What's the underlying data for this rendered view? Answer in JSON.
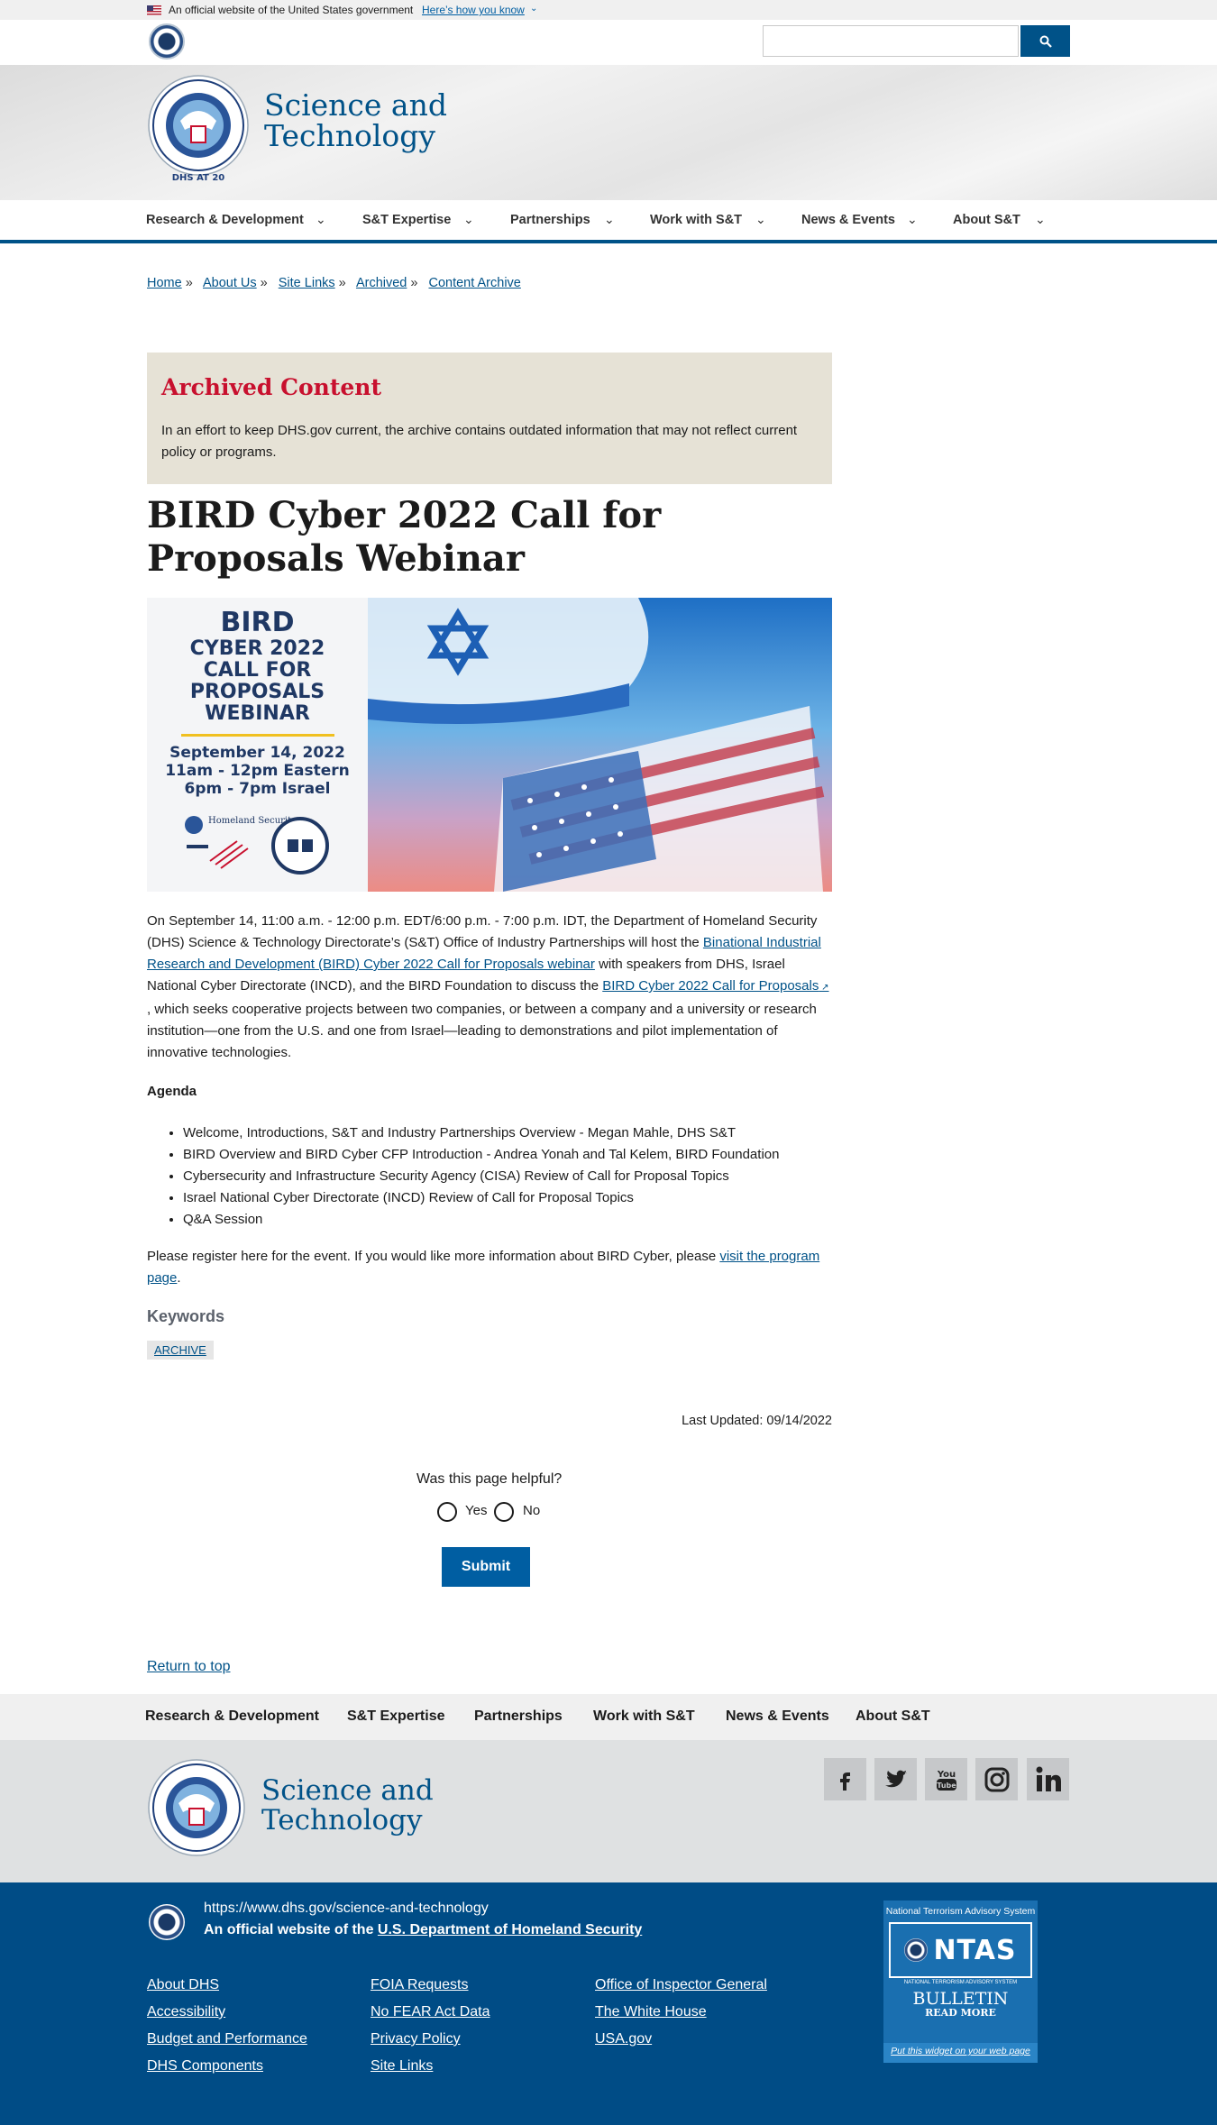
{
  "gov_banner": {
    "text": "An official website of the United States government",
    "how_link": "Here’s how you know"
  },
  "brand": {
    "line1": "Science and",
    "line2": "Technology",
    "seal_text": "DHS AT 20"
  },
  "main_nav": [
    "Research & Development",
    "S&T Expertise",
    "Partnerships",
    "Work with S&T",
    "News & Events",
    "About S&T"
  ],
  "breadcrumb": [
    "Home",
    "About Us",
    "Site Links",
    "Archived",
    "Content Archive"
  ],
  "archive": {
    "title": "Archived Content",
    "text": "In an effort to keep DHS.gov current, the archive contains outdated information that may not reflect current policy or programs."
  },
  "page_title": "BIRD Cyber 2022 Call for Proposals Webinar",
  "event_image": {
    "bird": "BIRD",
    "line1": "CYBER 2022",
    "line2": "CALL FOR",
    "line3": "PROPOSALS",
    "line4": "WEBINAR",
    "date": "September 14, 2022",
    "time1": "11am - 12pm Eastern",
    "time2": "6pm - 7pm Israel",
    "logo_text": "Homeland Security"
  },
  "intro": {
    "p1": "On September 14, 11:00 a.m. - 12:00 p.m. EDT/6:00 p.m. - 7:00 p.m. IDT, the Department of Homeland Security (DHS) Science & Technology Directorate’s (S&T) Office of Industry Partnerships will host the ",
    "link1": "Binational Industrial Research and Development (BIRD) Cyber 2022 Call for Proposals webinar",
    "p2": " with speakers from DHS, Israel National Cyber Directorate (INCD), and the BIRD Foundation to discuss the ",
    "link2": "BIRD Cyber 2022 Call for Proposals",
    "p3": " , which seeks cooperative projects between two companies, or between a company and a university or research institution—one from the U.S. and one from Israel—leading to demonstrations and pilot implementation of innovative technologies."
  },
  "agenda": {
    "heading": "Agenda",
    "items": [
      "Welcome, Introductions, S&T and Industry Partnerships Overview - Megan Mahle, DHS S&T",
      "BIRD Overview and BIRD Cyber CFP Introduction - Andrea Yonah and Tal Kelem, BIRD Foundation",
      "Cybersecurity and Infrastructure Security Agency (CISA) Review of Call for Proposal Topics",
      "Israel National Cyber Directorate (INCD) Review of Call for Proposal Topics",
      "Q&A Session"
    ]
  },
  "register": {
    "text": "Please register here for the event. If you would like more information about BIRD Cyber, please ",
    "link": "visit the program page",
    "end": "."
  },
  "keywords": {
    "heading": "Keywords",
    "tag": "ARCHIVE"
  },
  "last_updated": "Last Updated: 09/14/2022",
  "feedback": {
    "question": "Was this page helpful?",
    "yes": "Yes",
    "no": "No",
    "submit": "Submit"
  },
  "return_top": "Return to top",
  "footer_nav": [
    "Research & Development",
    "S&T Expertise",
    "Partnerships",
    "Work with S&T",
    "News & Events",
    "About S&T"
  ],
  "social": [
    "facebook-icon",
    "twitter-icon",
    "youtube-icon",
    "instagram-icon",
    "linkedin-icon"
  ],
  "identifier": {
    "url": "https://www.dhs.gov/science-and-technology",
    "official_prefix": "An official website of the ",
    "official_link": "U.S. Department of Homeland Security",
    "links_col1": [
      "About DHS",
      "Accessibility",
      "Budget and Performance",
      "DHS Components"
    ],
    "links_col2": [
      "FOIA Requests",
      "No FEAR Act Data",
      "Privacy Policy",
      "Site Links"
    ],
    "links_col3": [
      "Office of Inspector General",
      "The White House",
      "USA.gov"
    ]
  },
  "ntas": {
    "title": "National Terrorism Advisory System",
    "logo": "NTAS",
    "sub": "NATIONAL TERRORISM ADVISORY SYSTEM",
    "bulletin": "BULLETIN",
    "read_more": "READ MORE",
    "put": "Put this widget on your web page"
  },
  "colors": {
    "primary": "#005288",
    "archive_red": "#c8102e",
    "archive_bg": "#e6e2d6",
    "footer_blue": "#004c86"
  }
}
